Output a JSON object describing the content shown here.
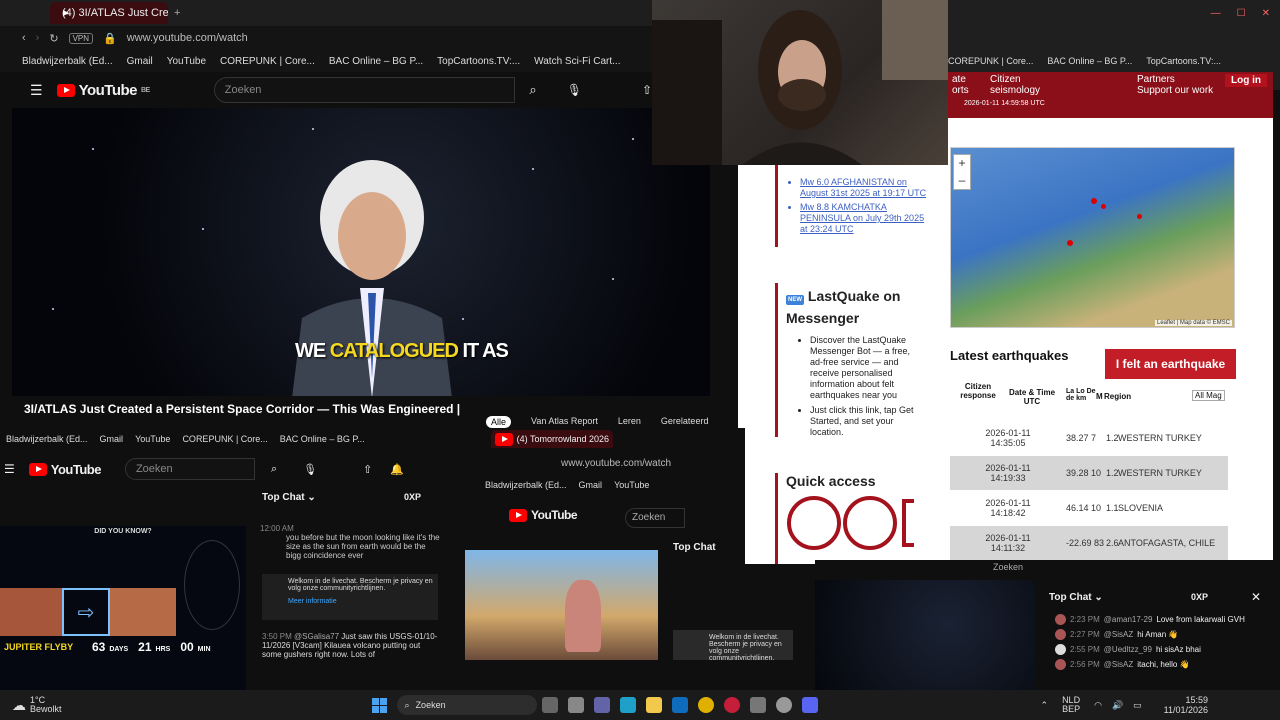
{
  "browser_main": {
    "tab_label": "(4) 3I/ATLAS Just Crea",
    "vpn_label": "VPN",
    "url": "www.youtube.com/watch",
    "bookmarks": [
      "Bladwijzerbalk (Ed...",
      "Gmail",
      "YouTube",
      "COREPUNK | Core...",
      "BAC Online – BG P...",
      "TopCartoons.TV:...",
      "Watch Sci-Fi Cart..."
    ]
  },
  "youtube_main": {
    "logo": "YouTube",
    "region": "BE",
    "search_placeholder": "Zoeken",
    "caption_plain": "WE",
    "caption_highlight": "CATALOGUED",
    "caption_end": "IT AS",
    "video_title": "3I/ATLAS Just Created a Persistent Space Corridor — This Was Engineered |",
    "chips": [
      "Alle",
      "Van Atlas Report",
      "Leren",
      "Gerelateerd"
    ]
  },
  "browser_right": {
    "bookmarks": [
      "COREPUNK | Core...",
      "BAC Online – BG P...",
      "TopCartoons.TV:..."
    ]
  },
  "emsc": {
    "nav": [
      "ate",
      "orts",
      "Citizen",
      "seismology",
      "Partners",
      "Support our work"
    ],
    "login": "Log in",
    "timestamp": "2026-01-11 14:59:58 UTC",
    "recent_links": [
      "Mw 6.0 AFGHANISTAN on August 31st 2025 at 19:17 UTC",
      "Mw 8.8 KAMCHATKA PENINSULA on July 29th 2025 at 23:24 UTC"
    ],
    "lastquake_title": "LastQuake on Messenger",
    "lastquake_badge": "NEW",
    "lastquake_item1": "Discover the LastQuake Messenger Bot — a free, ad-free service — and receive personalised information about felt earthquakes near you",
    "lastquake_item2": "Just click this link, tap Get Started, and set your location.",
    "quick_access": "Quick access",
    "map_attribution": "Leaflet | Map data © EMSC",
    "latest_title": "Latest earthquakes",
    "felt_button": "I felt an earthquake",
    "table_headers": [
      "Citizen response",
      "Date & Time UTC",
      "La Lo De de km",
      "M",
      "Region"
    ],
    "filter_select": "All Mag",
    "rows": [
      {
        "date": "2026-01-11",
        "time": "14:35:05",
        "data": "38.27  7",
        "mag": "1.2",
        "region": "WESTERN TURKEY"
      },
      {
        "date": "2026-01-11",
        "time": "14:19:33",
        "data": "39.28 10",
        "mag": "1.2",
        "region": "WESTERN TURKEY"
      },
      {
        "date": "2026-01-11",
        "time": "14:18:42",
        "data": "46.14 10",
        "mag": "1.1",
        "region": "SLOVENIA"
      },
      {
        "date": "2026-01-11",
        "time": "14:11:32",
        "data": "-22.69 83",
        "mag": "2.6",
        "region": "ANTOFAGASTA, CHILE"
      }
    ]
  },
  "browser_bl": {
    "bookmarks": [
      "Bladwijzerbalk (Ed...",
      "Gmail",
      "YouTube",
      "COREPUNK | Core...",
      "BAC Online – BG P..."
    ],
    "search_placeholder": "Zoeken",
    "top_chat": "Top Chat",
    "xp": "0XP",
    "did_you_know": "DID YOU KNOW?",
    "jupiter": "JUPITER FLYBY",
    "days": "63",
    "days_label": "DAYS",
    "hrs": "21",
    "hrs_label": "HRS",
    "mins": "00",
    "mins_label": "MIN",
    "chat_time1": "12:00 AM",
    "chat_msg1": "you before but the moon looking like it's the size as the sun from earth would be the bigg coincidence ever",
    "welcome": "Welkom in de livechat. Bescherm je privacy en volg onze communityrichtlijnen.",
    "more_info": "Meer informatie",
    "chat_time2": "3:50 PM",
    "chat_user2": "@SGalisa77",
    "chat_msg2": "Just saw this USGS-01/10-11/2026 [V3cam] Kilauea volcano putting out some gushers right now. Lots of"
  },
  "browser_bm": {
    "tab_label": "(4) Tomorrowland 2026",
    "url": "www.youtube.com/watch",
    "bookmarks": [
      "Bladwijzerbalk (Ed...",
      "Gmail",
      "YouTube"
    ],
    "search_placeholder": "Zoeken",
    "top_chat": "Top Chat",
    "welcome": "Welkom in de livechat. Bescherm je privacy en volg onze communityrichtlijnen."
  },
  "browser_br": {
    "search_placeholder": "Zoeken",
    "top_chat": "Top Chat",
    "xp": "0XP",
    "chat": [
      {
        "time": "2:23 PM",
        "user": "@aman17-29",
        "msg": "Love from lakarwali GVH"
      },
      {
        "time": "2:27 PM",
        "user": "@SisAZ",
        "msg": "hi Aman 👋"
      },
      {
        "time": "2:55 PM",
        "user": "@Uedltzz_99",
        "msg": "hi sisAz bhai"
      },
      {
        "time": "2:56 PM",
        "user": "@SisAZ",
        "msg": "itachi, hello 👋"
      }
    ]
  },
  "taskbar": {
    "weather_temp": "1°C",
    "weather_desc": "Bewolkt",
    "search": "Zoeken",
    "lang1": "NLD",
    "lang2": "BEP",
    "time": "15:59",
    "date": "11/01/2026"
  }
}
